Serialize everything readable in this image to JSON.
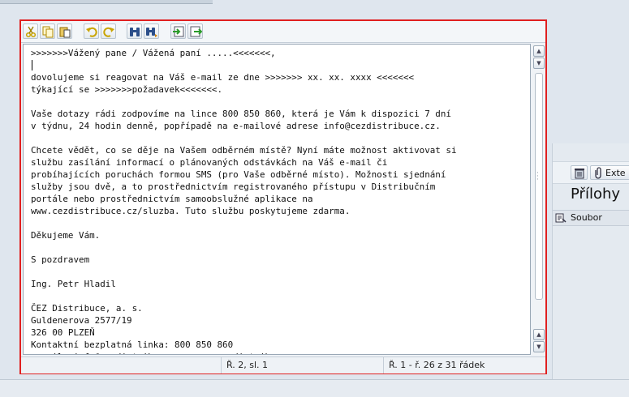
{
  "toolbar": {
    "buttons": [
      {
        "name": "cut-button",
        "icon": "scissors-icon"
      },
      {
        "name": "copy-button",
        "icon": "copy-icon"
      },
      {
        "name": "paste-button",
        "icon": "paste-icon"
      },
      {
        "name": "undo-button",
        "icon": "undo-icon"
      },
      {
        "name": "redo-button",
        "icon": "redo-icon"
      },
      {
        "name": "find-button",
        "icon": "binoculars-icon"
      },
      {
        "name": "find-next-button",
        "icon": "binoculars-next-icon"
      },
      {
        "name": "import-button",
        "icon": "import-icon"
      },
      {
        "name": "export-button",
        "icon": "export-icon"
      }
    ]
  },
  "editor": {
    "lines": [
      ">>>>>>>Vážený pane / Vážená paní .....<<<<<<<,",
      "",
      "dovolujeme si reagovat na Váš e-mail ze dne >>>>>>> xx. xx. xxxx <<<<<<<",
      "týkající se >>>>>>>požadavek<<<<<<<.",
      "",
      "Vaše dotazy rádi zodpovíme na lince 800 850 860, která je Vám k dispozici 7 dní",
      "v týdnu, 24 hodin denně, popřípadě na e-mailové adrese info@cezdistribuce.cz.",
      "",
      "Chcete vědět, co se děje na Vašem odběrném místě? Nyní máte možnost aktivovat si",
      "službu zasílání informací o plánovaných odstávkách na Váš e-mail či",
      "probíhajících poruchách formou SMS (pro Vaše odběrné místo). Možnosti sjednání",
      "služby jsou dvě, a to prostřednictvím registrovaného přístupu v Distribučním",
      "portále nebo prostřednictvím samoobslužné aplikace na",
      "www.cezdistribuce.cz/sluzba. Tuto službu poskytujeme zdarma.",
      "",
      "Děkujeme Vám.",
      "",
      "S pozdravem",
      "",
      "Ing. Petr Hladil",
      "",
      "ČEZ Distribuce, a. s.",
      "Guldenerova 2577/19",
      "326 00 PLZEŇ",
      "Kontaktní bezplatná linka: 800 850 860",
      "e-mail: info@cezdistribuce.cz, www.cezdistribuce.cz"
    ]
  },
  "status": {
    "cursor_position": "Ř. 2, sl. 1",
    "line_range": "Ř. 1 - ř. 26 z 31 řádek"
  },
  "attachments": {
    "delete_icon": "trash-icon",
    "external_label": "Exte",
    "title": "Přílohy",
    "column_header": "Soubor"
  },
  "colors": {
    "highlight_border": "#e02020",
    "background": "#dfe6ee"
  }
}
